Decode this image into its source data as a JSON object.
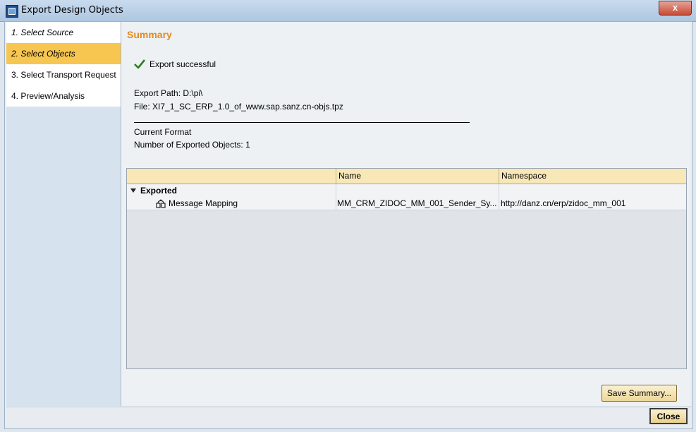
{
  "window": {
    "title": "Export Design Objects"
  },
  "steps": [
    {
      "label": "1. Select Source"
    },
    {
      "label": "2. Select Objects"
    },
    {
      "label": "3. Select Transport Request"
    },
    {
      "label": "4. Preview/Analysis"
    }
  ],
  "summary": {
    "heading": "Summary",
    "status": "Export successful",
    "export_path": "Export Path: D:\\pi\\",
    "file": "File: XI7_1_SC_ERP_1.0_of_www.sap.sanz.cn-objs.tpz",
    "current_format": "Current Format",
    "exported_count": "Number of Exported Objects: 1"
  },
  "table": {
    "columns": [
      "",
      "Name",
      "Namespace"
    ],
    "group_label": "Exported",
    "rows": [
      {
        "type": "Message Mapping",
        "name": "MM_CRM_ZIDOC_MM_001_Sender_Sy...",
        "namespace": "http://danz.cn/erp/zidoc_mm_001"
      }
    ]
  },
  "buttons": {
    "save_summary": "Save Summary...",
    "close": "Close",
    "window_close": "x"
  },
  "colors": {
    "accent_orange": "#e28a1e",
    "active_step": "#f6c650",
    "header_bg": "#f8e8b8"
  }
}
